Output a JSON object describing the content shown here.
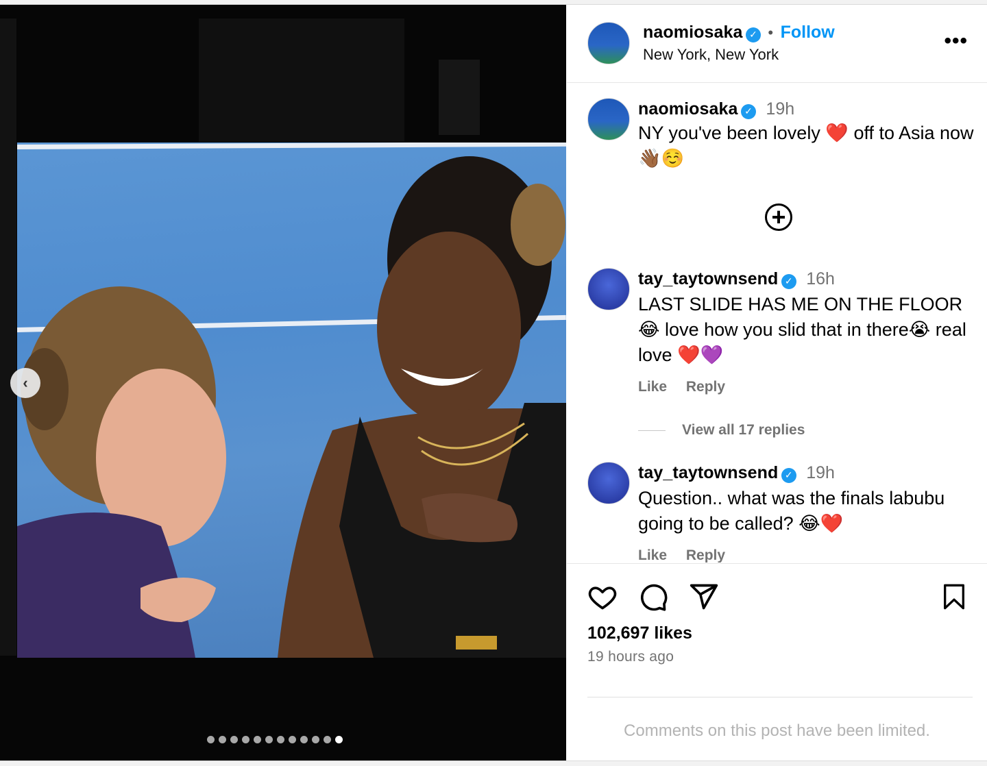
{
  "post": {
    "author": "naomiosaka",
    "follow_label": "Follow",
    "dot_separator": "•",
    "location": "New York, New York",
    "more_label": "•••"
  },
  "caption": {
    "username": "naomiosaka",
    "time": "19h",
    "text": "NY you've been lovely ❤️ off to Asia now 👋🏾☺️"
  },
  "comments": [
    {
      "username": "tay_taytownsend",
      "time": "16h",
      "text": "LAST SLIDE HAS ME ON THE FLOOR😂 love how you slid that in there😭 real love ❤️💜",
      "like_label": "Like",
      "reply_label": "Reply",
      "view_replies": "View all 17 replies"
    },
    {
      "username": "tay_taytownsend",
      "time": "19h",
      "text": "Question.. what was the finals labubu going to be called? 😂❤️",
      "like_label": "Like",
      "reply_label": "Reply"
    }
  ],
  "stats": {
    "likes": "102,697 likes",
    "posted": "19 hours ago"
  },
  "footer": {
    "limited": "Comments on this post have been limited."
  },
  "carousel": {
    "total_slides": 12,
    "current_slide": 12,
    "prev_label": "‹"
  },
  "colors": {
    "accent": "#0095f6",
    "verified": "#1d9bf0",
    "muted": "#737373"
  },
  "icons": [
    "heart-icon",
    "comment-icon",
    "share-icon",
    "bookmark-icon",
    "add-comment-icon",
    "verified-icon",
    "more-icon",
    "chevron-left-icon"
  ]
}
